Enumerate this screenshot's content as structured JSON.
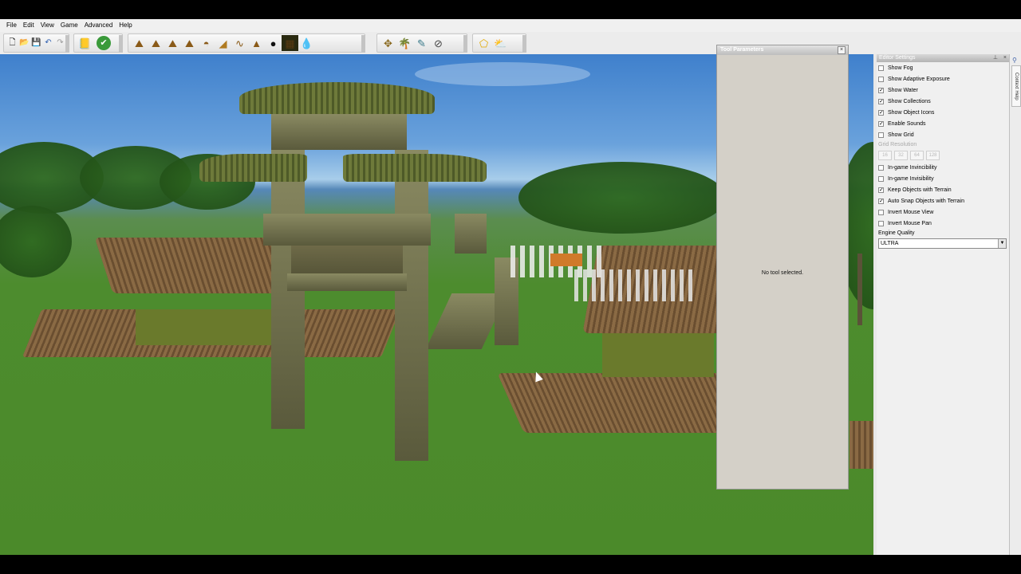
{
  "menu": {
    "items": [
      "File",
      "Edit",
      "View",
      "Game",
      "Advanced",
      "Help"
    ]
  },
  "toolbar": {
    "group1": [
      {
        "icon": "new-file-icon",
        "glyph": "🗋"
      },
      {
        "icon": "open-folder-icon",
        "glyph": "📂"
      },
      {
        "icon": "save-icon",
        "glyph": "💾"
      },
      {
        "icon": "undo-icon",
        "glyph": "↶"
      },
      {
        "icon": "redo-icon",
        "glyph": "↷"
      }
    ],
    "group2": [
      {
        "icon": "objectives-book-icon",
        "glyph": "📒"
      },
      {
        "icon": "validate-check-icon",
        "glyph": "✔"
      }
    ],
    "group3": [
      {
        "icon": "terrain-raise-icon",
        "glyph": "⛰"
      },
      {
        "icon": "terrain-smooth-icon",
        "glyph": "⛰"
      },
      {
        "icon": "terrain-flatten-icon",
        "glyph": "⛰"
      },
      {
        "icon": "terrain-plateau-icon",
        "glyph": "⛰"
      },
      {
        "icon": "terrain-hill-icon",
        "glyph": "◓"
      },
      {
        "icon": "terrain-ramp-icon",
        "glyph": "◢"
      },
      {
        "icon": "road-path-icon",
        "glyph": "∿"
      },
      {
        "icon": "terrain-mountain-icon",
        "glyph": "▲"
      },
      {
        "icon": "hole-icon",
        "glyph": "●"
      },
      {
        "icon": "texture-paint-icon",
        "glyph": "▦"
      },
      {
        "icon": "water-drop-icon",
        "glyph": "💧"
      }
    ],
    "group4": [
      {
        "icon": "object-place-icon",
        "glyph": "✥"
      },
      {
        "icon": "vegetation-icon",
        "glyph": "🌴"
      },
      {
        "icon": "object-edit-icon",
        "glyph": "✎"
      },
      {
        "icon": "selection-icon",
        "glyph": "⊘"
      }
    ],
    "group5": [
      {
        "icon": "polygon-zone-icon",
        "glyph": "⬠"
      },
      {
        "icon": "weather-icon",
        "glyph": "⛅"
      }
    ]
  },
  "tool_parameters": {
    "title": "Tool Parameters",
    "empty_text": "No tool selected."
  },
  "editor_settings": {
    "title": "Editor Settings",
    "options_a": [
      {
        "label": "Show Fog",
        "checked": false
      },
      {
        "label": "Show Adaptive Exposure",
        "checked": false
      },
      {
        "label": "Show Water",
        "checked": true
      },
      {
        "label": "Show Collections",
        "checked": true
      },
      {
        "label": "Show Object Icons",
        "checked": true
      },
      {
        "label": "Enable Sounds",
        "checked": true
      },
      {
        "label": "Show Grid",
        "checked": false
      }
    ],
    "grid_resolution_label": "Grid Resolution",
    "grid_values": [
      "16",
      "32",
      "64",
      "128"
    ],
    "options_b": [
      {
        "label": "In-game Invincibility",
        "checked": false
      },
      {
        "label": "In-game Invisibility",
        "checked": false
      },
      {
        "label": "Keep Objects with Terrain",
        "checked": true
      },
      {
        "label": "Auto Snap Objects with Terrain",
        "checked": true
      },
      {
        "label": "Invert Mouse View",
        "checked": false
      },
      {
        "label": "Invert Mouse Pan",
        "checked": false
      }
    ],
    "engine_quality_label": "Engine Quality",
    "engine_quality_value": "ULTRA",
    "check_glyph": "✓"
  },
  "context_help": {
    "label": "Context Help"
  },
  "colors": {
    "menubar_bg": "#f0f0f0",
    "panel_bg": "#d4d0c8",
    "grass": "#4b8a2a",
    "sky": "#6aa2dc"
  }
}
